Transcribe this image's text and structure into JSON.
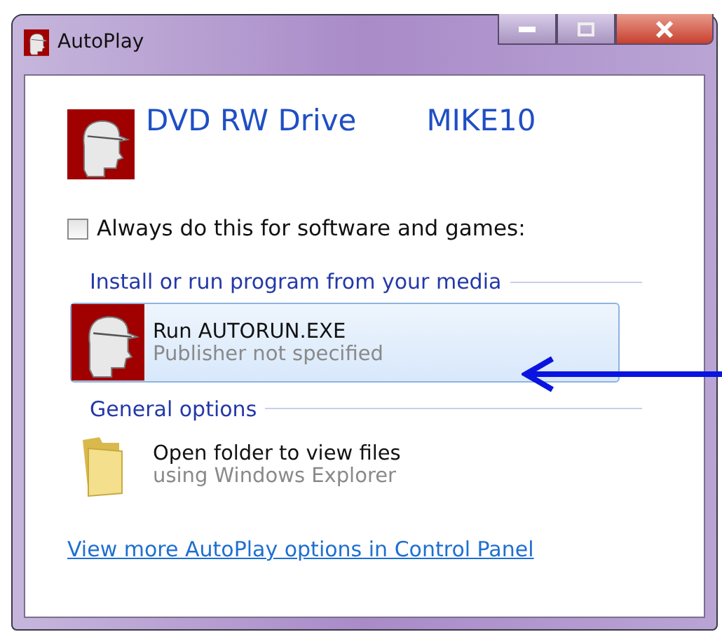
{
  "window": {
    "title": "AutoPlay"
  },
  "device": {
    "name": "DVD RW Drive",
    "label": "MIKE10"
  },
  "always_checkbox": {
    "label": "Always do this for software and games:",
    "checked": false
  },
  "sections": [
    {
      "title": "Install or run program from your media",
      "options": [
        {
          "kind": "program",
          "title": "Run AUTORUN.EXE",
          "subtitle": "Publisher not specified",
          "selected": true
        }
      ]
    },
    {
      "title": "General options",
      "options": [
        {
          "kind": "folder",
          "title": "Open folder to view files",
          "subtitle": "using Windows Explorer",
          "selected": false
        }
      ]
    }
  ],
  "link": "View more AutoPlay options in Control Panel"
}
